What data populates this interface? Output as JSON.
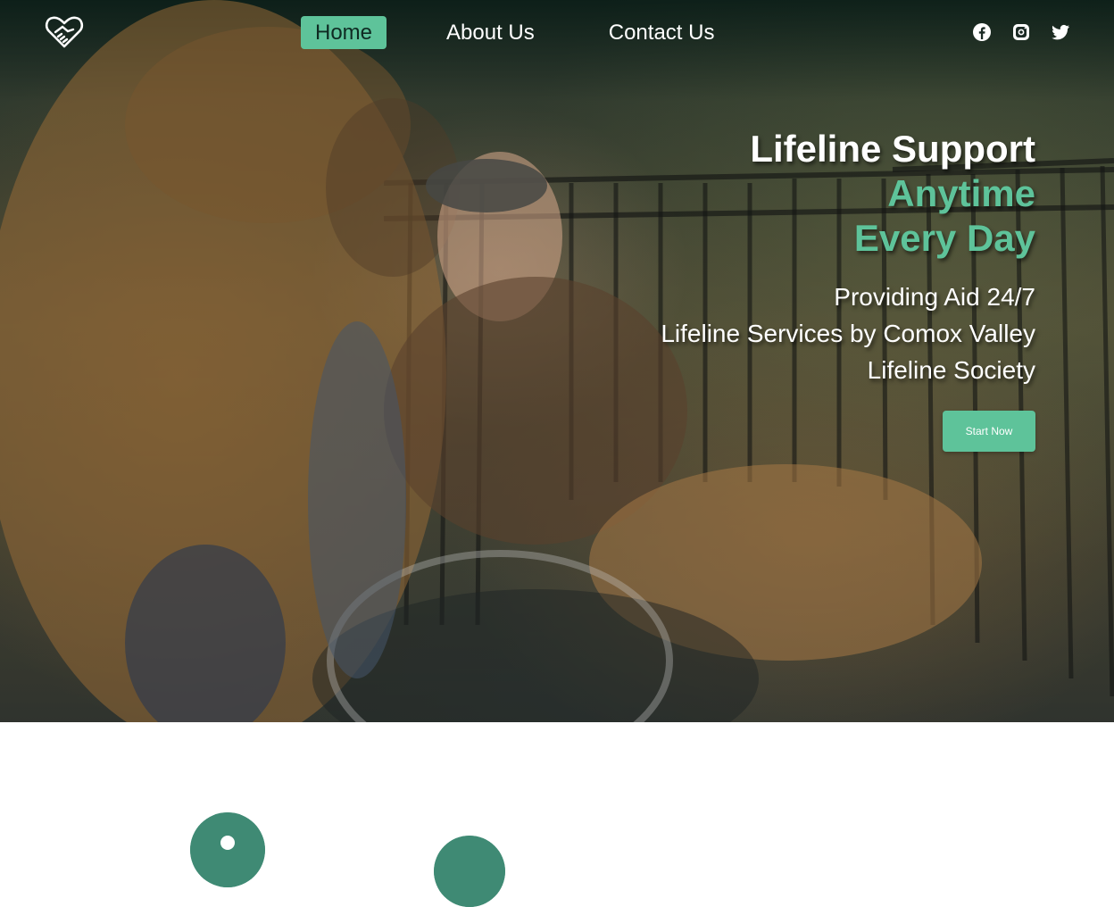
{
  "nav": {
    "logo_icon": "heart-handshake-icon",
    "links": [
      {
        "label": "Home",
        "active": true
      },
      {
        "label": "About Us",
        "active": false
      },
      {
        "label": "Contact Us",
        "active": false
      }
    ],
    "social": [
      "facebook-icon",
      "instagram-icon",
      "twitter-icon"
    ]
  },
  "hero": {
    "title": "Lifeline Support",
    "title_accent_1": "Anytime",
    "title_accent_2": "Every Day",
    "sub_1": "Providing Aid 24/7",
    "sub_2": "Lifeline Services by Comox Valley",
    "sub_3": "Lifeline Society",
    "cta": "Start Now"
  },
  "features": {
    "icons": [
      "location-pin-icon",
      "feature-circle-icon"
    ]
  },
  "colors": {
    "accent": "#5ec39a",
    "accent_dark": "#3f8a74",
    "text_light": "#ffffff"
  }
}
